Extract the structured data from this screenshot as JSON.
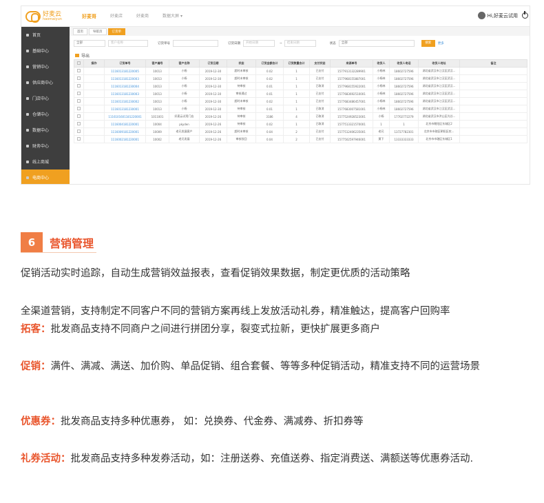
{
  "app": {
    "logo_text": "好麦云",
    "logo_sub": "haomaiyun",
    "nav": [
      "好麦哥",
      "好麦店",
      "好麦商",
      "数据大屏 ▾"
    ],
    "user_greeting": "Hi,好麦云试用",
    "sidebar": [
      "首页",
      "基础中心",
      "营销中心",
      "供应商中心",
      "门店中心",
      "仓储中心",
      "数据中心",
      "财务中心",
      "线上商城",
      "电商中心"
    ],
    "breadcrumbs": [
      "首页",
      "导航页",
      "订货单"
    ],
    "filters": {
      "select_all": "全部",
      "customer_placeholder": "客户名称",
      "order_no_label": "订货单号",
      "order_date_label": "订货日期",
      "date_from": "开始日期",
      "date_sep": "~",
      "date_to": "结束日期",
      "status_label": "状态",
      "status_value": "全部",
      "search_button": "搜索",
      "more_link": "更多"
    },
    "export_label": "导出",
    "table": {
      "headers": [
        "",
        "操作",
        "订货单号",
        "客户编号",
        "客户名称",
        "订货日期",
        "状态",
        "订货金额合计",
        "订货数量合计",
        "支付状态",
        "来源单号",
        "收货人",
        "收货人电话",
        "收货人地址",
        "备注"
      ],
      "rows": [
        [
          "",
          "",
          "1116013181220005",
          "10013",
          "小杨",
          "2019-12-30",
          "超时未审核",
          "0.02",
          "1",
          "已支付",
          "1577913132289901",
          "小杨林",
          "18602727596",
          "湖北省武汉市江汉区武汉...",
          ""
        ],
        [
          "",
          "",
          "1116013181220003",
          "10013",
          "小杨",
          "2019-12-30",
          "超时未审核",
          "0.02",
          "1",
          "已支付",
          "1577968155887001",
          "小杨林",
          "18602727596",
          "湖北省武汉市江汉区武汉...",
          ""
        ],
        [
          "",
          "",
          "1116013181230004",
          "10013",
          "小杨",
          "2019-12-30",
          "待审核",
          "0.01",
          "1",
          "已取消",
          "1577968155922001",
          "小杨林",
          "18602727596",
          "湖北省武汉市江汉区武汉...",
          ""
        ],
        [
          "",
          "",
          "1116013181230003",
          "10013",
          "小杨",
          "2019-12-30",
          "审核通过",
          "0.01",
          "1",
          "已支付",
          "1577683692510001",
          "小杨林",
          "18602727596",
          "湖北省武汉市江汉区武汉...",
          ""
        ],
        [
          "",
          "",
          "1116013181230002",
          "10013",
          "小杨",
          "2019-12-30",
          "超时未审核",
          "0.02",
          "1",
          "已支付",
          "1577683486457001",
          "小杨林",
          "18602727596",
          "湖北省武汉市江汉区武汉...",
          ""
        ],
        [
          "",
          "",
          "1116013181230001",
          "10013",
          "小杨",
          "2019-12-30",
          "待审核",
          "0.01",
          "1",
          "已取消",
          "1577683007581001",
          "小杨林",
          "18602727596",
          "湖北省武汉市江汉区武汉...",
          ""
        ],
        [
          "",
          "",
          "1116101601181220001",
          "1011001",
          "好麦云试用门店",
          "2019-12-26",
          "待审核",
          "3186",
          "4",
          "已取消",
          "1577524928523001",
          "小杨",
          "17702772279",
          "湖北省武汉市洪山区光谷...",
          ""
        ],
        [
          "",
          "",
          "1116004181220001",
          "10004",
          "pkyden",
          "2019-12-26",
          "待审核",
          "0.02",
          "1",
          "已取消",
          "1577513321570001",
          "1",
          "1",
          "北京市朝阳区东城区2",
          ""
        ],
        [
          "",
          "",
          "1116009181220001",
          "10009",
          "老兄发展客户",
          "2019-12-26",
          "超时未审核",
          "0.04",
          "2",
          "已支付",
          "1577512406235001",
          "老兄",
          "13727782301",
          "北京市市辖区朝阳区农...",
          ""
        ],
        [
          "",
          "",
          "1116002181220001",
          "10002",
          "老兄发展",
          "2019-12-26",
          "审核驳回",
          "0.04",
          "2",
          "已支付",
          "1577502597946001",
          "黄下",
          "13333333333",
          "北京市市辖区东城区1",
          ""
        ]
      ]
    }
  },
  "section": {
    "number": "6",
    "title": "营销管理"
  },
  "paragraphs": {
    "p1": "促销活动实时追踪，自动生成营销效益报表，查看促销效果数据，制定更优质的活动策略",
    "p2": "全渠道营销，支持制定不同客户不同的营销方案再线上发放活动礼券，精准触达，提高客户回购率",
    "p3_label": "拓客：",
    "p3_text": "批发商品支持不同商户之间进行拼团分享，裂变式拉新，更快扩展更多商户",
    "p4_label": "促销：",
    "p4_text": "满件、满减、满送、加价购、单品促销、组合套餐、等等多种促销活动，精准支持不同的运营场景",
    "p5_label": "优惠券：",
    "p5_text": "批发商品支持多种优惠券，  如：兑换券、代金券、满减券、折扣券等",
    "p6_label": "礼券活动：",
    "p6_text": "批发商品支持多种发券活动，如：注册送券、充值送券、指定消费送、满额送等优惠券活动."
  },
  "colors": {
    "accent": "#f0a020",
    "section_badge": "#f07e45",
    "highlight": "#e9552c",
    "link": "#3c8fd9",
    "sidebar_bg": "#3e3e3e"
  }
}
